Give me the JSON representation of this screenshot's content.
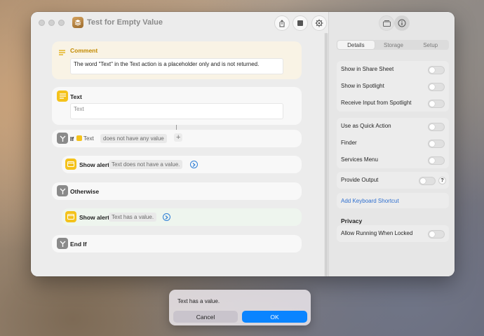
{
  "window": {
    "title": "Test for Empty Value",
    "toolbar": {
      "share_icon": "share-icon",
      "stop_icon": "stop-icon",
      "settings_icon": "gear-icon"
    }
  },
  "editor": {
    "comment": {
      "title": "Comment",
      "text": "The word \"Text\" in the Text action is a placeholder only and is not returned."
    },
    "text_action": {
      "title": "Text",
      "placeholder": "Text"
    },
    "if_action": {
      "keyword": "If",
      "variable": "Text",
      "condition": "does not have any value",
      "add_symbol": "+"
    },
    "show_alert_1": {
      "title": "Show alert",
      "message": "Text does not have a value."
    },
    "otherwise": {
      "title": "Otherwise"
    },
    "show_alert_2": {
      "title": "Show alert",
      "message": "Text has a value."
    },
    "end_if": {
      "title": "End If"
    }
  },
  "panel": {
    "tabs": [
      "Details",
      "Storage",
      "Setup"
    ],
    "active_tab": "Details",
    "options_group_1": [
      "Show in Share Sheet",
      "Show in Spotlight",
      "Receive Input from Spotlight"
    ],
    "options_group_2": [
      "Use as Quick Action",
      "Finder",
      "Services Menu"
    ],
    "provide_output": "Provide Output",
    "help_symbol": "?",
    "add_keyboard_shortcut": "Add Keyboard Shortcut",
    "privacy_header": "Privacy",
    "allow_running_locked": "Allow Running When Locked"
  },
  "alert": {
    "message": "Text has a value.",
    "cancel_label": "Cancel",
    "ok_label": "OK"
  },
  "colors": {
    "accent": "#0a84ff",
    "action_yellow": "#f4c21b",
    "link_blue": "#2f6fcf"
  }
}
